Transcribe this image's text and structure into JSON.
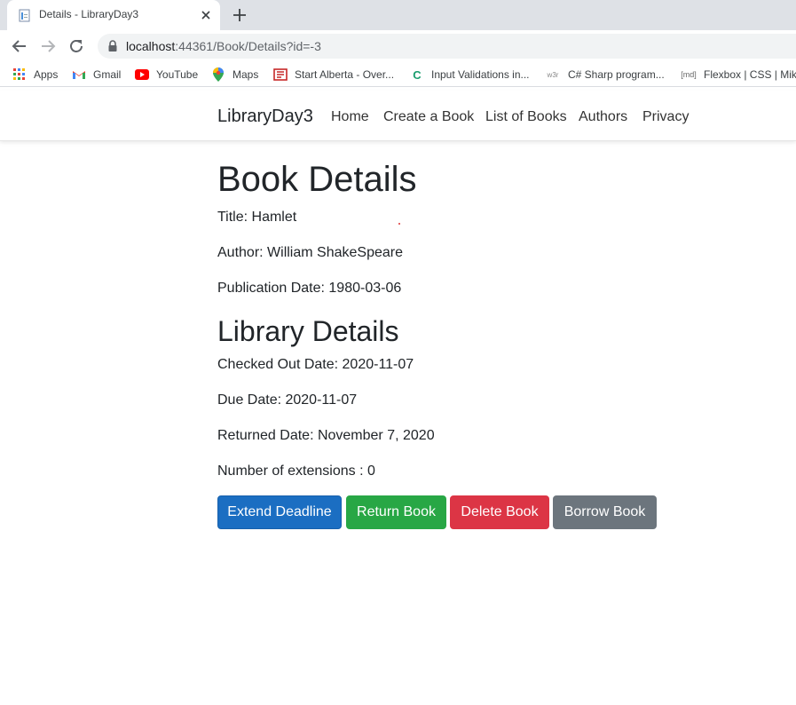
{
  "browser": {
    "tab_title": "Details - LibraryDay3",
    "url_host": "localhost",
    "url_path": ":44361/Book/Details?id=-3",
    "bookmarks": [
      {
        "label": "Apps",
        "icon": "apps-grid-icon"
      },
      {
        "label": "Gmail",
        "icon": "gmail-icon"
      },
      {
        "label": "YouTube",
        "icon": "youtube-icon"
      },
      {
        "label": "Maps",
        "icon": "maps-icon"
      },
      {
        "label": "Start Alberta - Over...",
        "icon": "start-alberta-icon"
      },
      {
        "label": "Input Validations in...",
        "icon": "c-icon"
      },
      {
        "label": "C# Sharp program...",
        "icon": "w3r-icon"
      },
      {
        "label": "Flexbox | CSS | Mike",
        "icon": "md-icon"
      }
    ]
  },
  "nav": {
    "brand": "LibraryDay3",
    "links": [
      "Home",
      "Create a Book",
      "List of Books",
      "Authors",
      "Privacy"
    ]
  },
  "book": {
    "heading": "Book Details",
    "title": "Title: Hamlet",
    "author": "Author: William ShakeSpeare",
    "publication_date": "Publication Date: 1980-03-06"
  },
  "library": {
    "heading": "Library Details",
    "checked_out": "Checked Out Date: 2020-11-07",
    "due": "Due Date: 2020-11-07",
    "returned": "Returned Date: November 7, 2020",
    "extensions": "Number of extensions : 0"
  },
  "actions": {
    "extend": "Extend Deadline",
    "return": "Return Book",
    "delete": "Delete Book",
    "borrow": "Borrow Book"
  },
  "colors": {
    "primary": "#1b6ec2",
    "success": "#28a745",
    "danger": "#dc3545",
    "secondary": "#6c757d"
  }
}
